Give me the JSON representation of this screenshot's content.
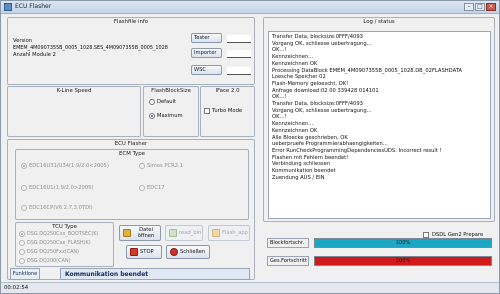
{
  "window": {
    "title": "ECU Flasher",
    "min_glyph": "–",
    "max_glyph": "□",
    "close_glyph": "×"
  },
  "flashfile": {
    "group_title": "Flashfile info",
    "version_label": "Version",
    "line1": "EMEM_4M0907355B_0005_1028.SES_4M0907355B_0005_1028",
    "line2": "Anzahl Module 2",
    "buttons": [
      "Tester",
      "Importer",
      "WSC"
    ]
  },
  "kline": {
    "group_title": "K-Line Speed"
  },
  "flashblocksize": {
    "group_title": "FlashBlockSize",
    "options": [
      {
        "label": "Default",
        "selected": false
      },
      {
        "label": "Maximum",
        "selected": true
      }
    ]
  },
  "iface": {
    "group_title": "IFace 2.0",
    "turbo_label": "Turbo Mode",
    "turbo_checked": false
  },
  "ecu_flasher": {
    "group_title": "ECU Flasher",
    "ecm_title": "ECM Type",
    "ecm_options": [
      {
        "label": "EDC16U31/U34(1.9/2.0<2005)",
        "selected": true
      },
      {
        "label": "Simos PCR2.1",
        "selected": false
      },
      {
        "label": "EDC16U1(1.9/2.0>2005)",
        "selected": false
      },
      {
        "label": "EDC17",
        "selected": false
      },
      {
        "label": "EDC16CP(V6 2.7,3.0TDI)",
        "selected": false
      }
    ],
    "tcu_title": "TCU Type",
    "tcu_options": [
      {
        "label": "DSG DQ250Cxx_BOOTSEC(K)",
        "selected": true
      },
      {
        "label": "DSG DQ250Cxx_FLASH(K)",
        "selected": false
      },
      {
        "label": "DSG DQ250Fxx(CAN)",
        "selected": false
      },
      {
        "label": "DSG DQ200(CAN)",
        "selected": false
      }
    ]
  },
  "actions": {
    "datei": "Datei öffnen",
    "read_bin": "read_bin",
    "flash_app": "Flash_app",
    "stop": "STOP",
    "schliessen": "Schließen"
  },
  "status": {
    "funktion_label": "Funktione",
    "message": "Kommunikation beendet"
  },
  "log": {
    "group_title": "Log / status",
    "lines": [
      "Transfer Data, blocksize:0FFF/4093",
      "Vorgang OK, schliesse uebertragung...",
      "OK...!",
      "Kennzeichnen...",
      "Kennzeichnen OK",
      "Processing DataBlock EMEM_4M0907355B_0005_1028.DB_02FLASHDATA",
      "Loesche Speicher 02",
      "Flash-Memory geloescht, OK!",
      "Anfrage download:02 00 339428 014101",
      "OK...!",
      "Transfer Data, blocksize:0FFF/4093",
      "Vorgang OK, schliesse uebertragung...",
      "OK...!",
      "Kennzeichnen...",
      "Kennzeichnen OK",
      "Alle Bloecke geschrieben, OK",
      "ueberpruefe Programmierabhaengigkeiten...",
      "Error RunCheckProgrammingDependenciesUDS: Incorrect result !",
      "Flashen mit Fehlern beendet!",
      "Verbindung schliessen",
      "Kommunikation beendet",
      "Zuendung AUS / EIN"
    ]
  },
  "dsdl": {
    "label": "DSDL Gen2 Prepare",
    "checked": false
  },
  "progress": [
    {
      "label": "Blockfortschr.",
      "value_text": "100%",
      "value": 1.0,
      "color": "#1aa7c4"
    },
    {
      "label": "Ges.Fortschritt",
      "value_text": "100%",
      "value": 1.0,
      "color": "#d11a1a"
    }
  ],
  "statusbar": {
    "time": "00:02:54"
  },
  "colors": {
    "accent": "#1d5fb0",
    "error": "#d11a1a",
    "info": "#1aa7c4"
  }
}
